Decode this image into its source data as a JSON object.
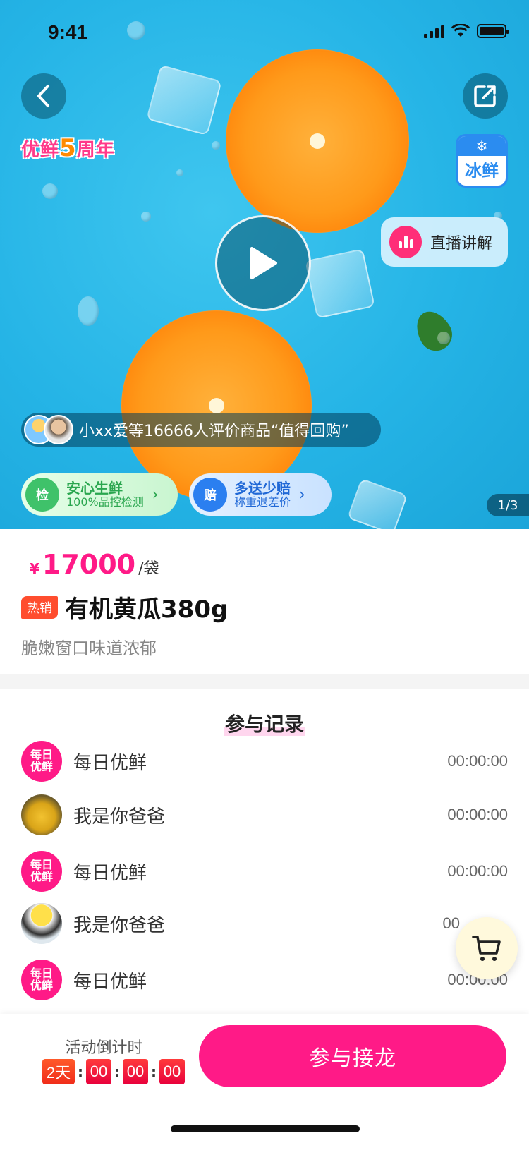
{
  "status_bar": {
    "time": "9:41"
  },
  "hero": {
    "anniversary": {
      "text1": "优鲜",
      "num": "5",
      "text2": "周年"
    },
    "frozen_label": "冰鲜",
    "live_label": "直播讲解",
    "review_text": "小xx爱等16666人评价商品“值得回购”",
    "badges": [
      {
        "icon": "检",
        "title": "安心生鲜",
        "subtitle": "100%品控检测"
      },
      {
        "icon": "赔",
        "title": "多送少赔",
        "subtitle": "称重退差价"
      }
    ],
    "pager": "1/3"
  },
  "product": {
    "currency": "¥",
    "price": "17000",
    "unit": "/袋",
    "tag": "热销",
    "title": "有机黄瓜380g",
    "subtitle": "脆嫩窗口味道浓郁"
  },
  "records": {
    "title": "参与记录",
    "brand_avatar_text": "每日优鲜",
    "items": [
      {
        "name": "每日优鲜",
        "time": "00:00:00",
        "avatar": "brand"
      },
      {
        "name": "我是你爸爸",
        "time": "00:00:00",
        "avatar": "tiger"
      },
      {
        "name": "每日优鲜",
        "time": "00:00:00",
        "avatar": "brand"
      },
      {
        "name": "我是你爸爸",
        "time": "00",
        "avatar": "cat"
      },
      {
        "name": "每日优鲜",
        "time": "00:00:00",
        "avatar": "brand"
      }
    ]
  },
  "bottom": {
    "countdown_label": "活动倒计时",
    "days": "2天",
    "hours": "00",
    "minutes": "00",
    "seconds": "00",
    "join_label": "参与接龙"
  },
  "colors": {
    "accent": "#ff1a87",
    "hero_bg": "#25b4e6"
  },
  "icons": [
    "back-icon",
    "share-icon",
    "play-icon",
    "live-icon",
    "cart-icon",
    "chevron-right-icon"
  ]
}
